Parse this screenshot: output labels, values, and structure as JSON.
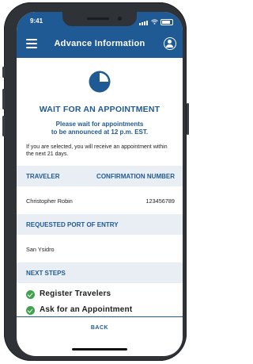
{
  "status_bar": {
    "time": "9:41"
  },
  "app_bar": {
    "title": "Advance Information",
    "menu_icon": "hamburger-menu-icon",
    "account_icon": "account-circle-icon"
  },
  "hero": {
    "icon": "clock-pending-icon",
    "heading": "WAIT FOR AN APPOINTMENT",
    "subheading_line1": "Please wait for appointments",
    "subheading_line2": "to be announced at 12 p.m. EST.",
    "description": "If you are selected, you will receive an appointment within the next 21 days."
  },
  "traveler_table": {
    "col_traveler": "TRAVELER",
    "col_confirmation": "CONFIRMATION NUMBER",
    "traveler_name": "Christopher Robin",
    "confirmation_number": "123456789"
  },
  "port_section": {
    "header": "REQUESTED PORT OF ENTRY",
    "value": "San Ysidro"
  },
  "next_steps": {
    "header": "NEXT STEPS",
    "steps": [
      {
        "label": "Register Travelers",
        "status": "done"
      },
      {
        "label": "Ask for an Appointment",
        "status": "done"
      }
    ]
  },
  "footer": {
    "back_label": "BACK"
  },
  "colors": {
    "brand": "#1f5a94",
    "band": "#e9eef5",
    "success": "#3fa34d"
  }
}
